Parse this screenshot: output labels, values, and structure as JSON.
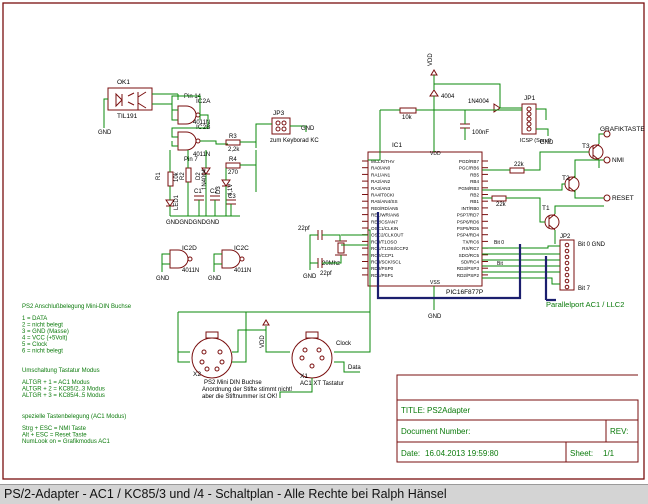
{
  "components": {
    "ok1": {
      "ref": "OK1",
      "part": "TIL191"
    },
    "ic2a": {
      "ref": "IC2A",
      "part": "4011N"
    },
    "ic2b": {
      "ref": "IC2B",
      "part": "4011N"
    },
    "ic2d": {
      "ref": "IC2D",
      "part": "4011N"
    },
    "ic2c": {
      "ref": "IC2C",
      "part": "4011N"
    },
    "pin14": "Pin 14",
    "pin7": "Pin 7",
    "r1": {
      "ref": "R1",
      "value": "10k"
    },
    "r2": {
      "ref": "R2"
    },
    "r3": {
      "ref": "R3",
      "value": "2,2k"
    },
    "r4": {
      "ref": "R4",
      "value": "270"
    },
    "led1": "LED1",
    "d2": "D2",
    "d3": "D3",
    "d1": "1N4004",
    "d1b": "4,1V",
    "c1": "C1",
    "c2": "C2",
    "c3": "C3",
    "gnd_row": "GNDGNDGNDGND",
    "jp3": {
      "ref": "JP3",
      "label": "zum Keyborad KC"
    },
    "jp1": {
      "ref": "JP1",
      "label": "ICSP (Sprut)"
    },
    "ic1": {
      "ref": "IC1",
      "part": "PIC16F877P",
      "left_pins": [
        "MCLR/THV",
        "RA0/AN0",
        "RA1/AN1",
        "RA2/AN2",
        "RA3/AN3",
        "RA4/T0CKI",
        "RA5/AN4/SS",
        "RE0/RD/AN5",
        "RE1/WR/AN6",
        "RE2/CS/AN7",
        "OSC1/CLKIN",
        "OSC2/CLKOUT",
        "RC0/T1OSO",
        "RC1/T1OSI/CCP2",
        "RC2/CCP1",
        "RC3/SCK/SCL",
        "RD0/PSP0",
        "RD1/PSP1"
      ],
      "right_pins": [
        "PGD/RB7",
        "PGC/RB6",
        "RB5",
        "RB4",
        "PGM/RB3",
        "RB2",
        "RB1",
        "INT/RB0",
        "PSP7/RD7",
        "PSP6/RD6",
        "PSP5/RD5",
        "PSP4/RD4",
        "TX/RC6",
        "RX/RC7",
        "SDO/RC5",
        "SDI/RC4",
        "RD3/PSP3",
        "RD2/PSP2"
      ],
      "vdd": "VDD",
      "vss": "VSS"
    },
    "r_10k": "10k",
    "d_1n4004": "1N4004",
    "d_4004": "4004",
    "c_100nf": "100nF",
    "r_22k_a": "22k",
    "r_22k_b": "22k",
    "c_22pf_a": "22pf",
    "c_22pf_b": "22pf",
    "xtal": "20Mhz",
    "clock_net": "Clock",
    "data_net": "Data",
    "t1": "T1",
    "t2": "T2",
    "t3": "T3",
    "grafiktaste": "GRAFIKTASTE",
    "nmi": "NMI",
    "reset": "RESET",
    "jp2": "JP2",
    "bit0": "Bit 0",
    "bit7": "Bit 7",
    "bit_gnd": "Bit 0 GND",
    "bit_label": "Bit",
    "parallelport": "Parallelport AC1 / LLC2",
    "x2": {
      "ref": "X2",
      "desc": "PS2 Mini DIN Buchse",
      "note1": "Anordnung der Stifte stimmt nicht!",
      "note2": "aber die Stiftnummer ist OK!"
    },
    "x1": {
      "ref": "X1",
      "desc": "AC1 XT Tastatur"
    },
    "vdd": "VDD",
    "gnd": "GND"
  },
  "notes": {
    "ps2_title": "PS2 Anschlußbelegung Mini-DIN Buchse",
    "ps2_lines": [
      "1 = DATA",
      "2 = nicht belegt",
      "3 = GND (Masse)",
      "4 = VCC (+5Volt)",
      "5 = Clock",
      "6 = nicht belegt"
    ],
    "mode_title": "Umschaltung Tastatur Modus",
    "mode_lines": [
      "ALTGR + 1 = AC1 Modus",
      "ALTGR + 2 = KC85/2..3 Modus",
      "ALTGR + 3 = KC85/4..5 Modus"
    ],
    "keys_title": "spezielle Tastenbelegung (AC1 Modus)",
    "keys_lines": [
      "Strg + ESC = NMI Taste",
      "Alt + ESC = Reset Taste",
      "NumLook on = Grafikmodus AC1"
    ]
  },
  "titleblock": {
    "title_label": "TITLE:",
    "title_value": "PS2Adapter",
    "docnum_label": "Document Number:",
    "rev_label": "REV:",
    "date_label": "Date:",
    "date_value": "16.04.2013 19:59:80",
    "sheet_label": "Sheet:",
    "sheet_value": "1/1"
  },
  "caption": "PS/2-Adapter - AC1 / KC85/3 und /4 - Schaltplan - Alle Rechte bei Ralph Hänsel",
  "colors": {
    "wire": "#0b8a0b",
    "part": "#000000",
    "bus": "#1b1f6e",
    "frame": "#7a0f0f",
    "label": "#0b7a0b"
  }
}
